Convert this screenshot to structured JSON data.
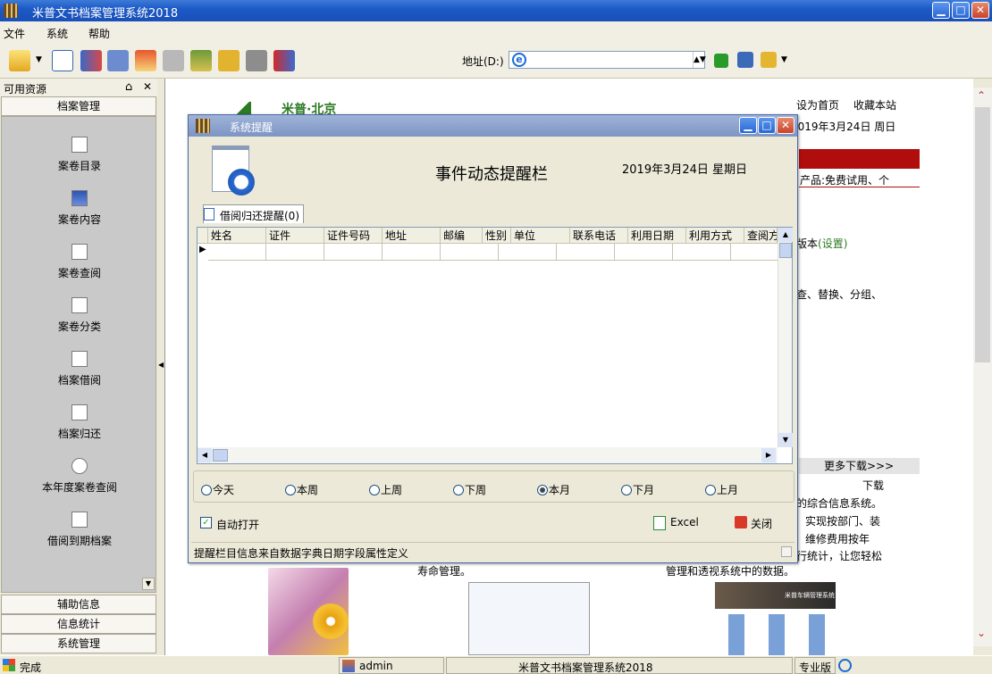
{
  "title_bar": {
    "title": "米普文书档案管理系统2018"
  },
  "menu": {
    "items": [
      "文件",
      "系统",
      "帮助"
    ]
  },
  "toolbar": {
    "address_label": "地址(D:)",
    "address_value": ""
  },
  "left_pane": {
    "title": "可用资源",
    "header": "档案管理",
    "items": [
      {
        "label": "案卷目录",
        "icon": "folder-icon"
      },
      {
        "label": "案卷内容",
        "icon": "grid-icon"
      },
      {
        "label": "案卷查阅",
        "icon": "search-doc-icon"
      },
      {
        "label": "案卷分类",
        "icon": "category-icon"
      },
      {
        "label": "档案借阅",
        "icon": "borrow-icon"
      },
      {
        "label": "档案归还",
        "icon": "return-icon"
      },
      {
        "label": "本年度案卷查阅",
        "icon": "magnifier-icon"
      },
      {
        "label": "借阅到期档案",
        "icon": "due-icon"
      }
    ],
    "bottom": [
      "辅助信息",
      "信息统计",
      "系统管理"
    ]
  },
  "web": {
    "brand": "米普·北京",
    "links": [
      "设为首页",
      "收藏本站"
    ],
    "date": "2019年3月24日 周日",
    "promo": "产品:免费试用、个",
    "edition_text": "版本",
    "edition_link": "(设置)",
    "features": "查、替换、分组、",
    "more_download": "更多下载>>>",
    "download": "下载",
    "lines": [
      "的综合信息系统。",
      "实现按部门、装",
      "维修费用按年",
      "行统计，让您轻松"
    ],
    "life": "寿命管理。",
    "manage": "管理和透视系统中的数据。",
    "car_title": "米普车辆管理系统"
  },
  "dialog": {
    "title": "系统提醒",
    "heading": "事件动态提醒栏",
    "date": "2019年3月24日  星期日",
    "tab": "借阅归还提醒(0)",
    "columns": [
      "姓名",
      "证件",
      "证件号码",
      "地址",
      "邮编",
      "性别",
      "单位",
      "联系电话",
      "利用日期",
      "利用方式",
      "查阅方"
    ],
    "radios": [
      {
        "label": "今天",
        "checked": false
      },
      {
        "label": "本周",
        "checked": false
      },
      {
        "label": "上周",
        "checked": false
      },
      {
        "label": "下周",
        "checked": false
      },
      {
        "label": "本月",
        "checked": true
      },
      {
        "label": "下月",
        "checked": false
      },
      {
        "label": "上月",
        "checked": false
      }
    ],
    "auto_open": "自动打开",
    "excel": "Excel",
    "close": "关闭",
    "footer": "提醒栏目信息来自数据字典日期字段属性定义"
  },
  "status": {
    "text": "完成",
    "user": "admin",
    "app": "米普文书档案管理系统2018",
    "edition": "专业版"
  },
  "colors": {
    "titlebar": "#1c5ac6",
    "dialog_title": "#7d95c4",
    "promo_bar": "#b00d0d",
    "brand_green": "#2c7a22"
  }
}
